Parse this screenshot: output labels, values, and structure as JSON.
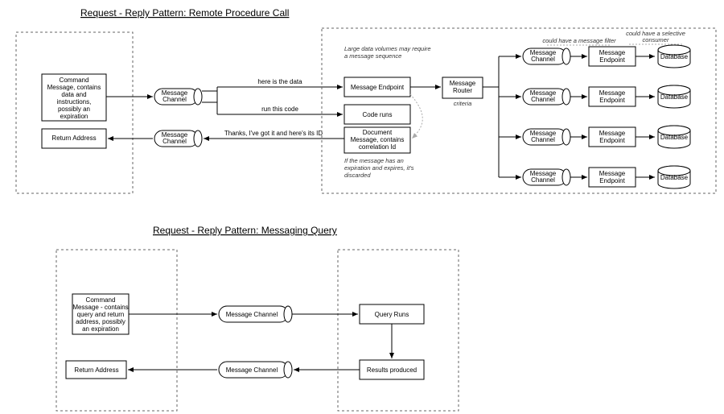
{
  "title1": "Request - Reply Pattern: Remote Procedure Call",
  "title2": "Request - Reply Pattern: Messaging Query",
  "commandMsg": [
    "Command",
    "Message, contains",
    "data and",
    "instructions,",
    "possibly an",
    "expiration"
  ],
  "returnAddr": "Return Address",
  "msgChannel": "Message\nChannel",
  "msgChannelFlat": "Message Channel",
  "hereData": "here is the data",
  "runCode": "run this code",
  "gotIt": "Thanks, I've got it and here's its ID",
  "largeData": [
    "Large data volumes may require",
    "a message sequence"
  ],
  "msgEndpoint": "Message Endpoint",
  "codeRuns": "Code runs",
  "docMsg": [
    "Document",
    "Message, contains",
    "correlation Id"
  ],
  "ifExpire": [
    "If the message has an",
    "expiration and expires, it's",
    "discarded"
  ],
  "msgRouter": "Message\nRouter",
  "criteria": "criteria",
  "couldFilter": "could have a message filter",
  "couldSelective": [
    "could have a selective",
    "consumer"
  ],
  "database": "Database",
  "commandMsg2": [
    "Command",
    "Message - contains",
    "query and return",
    "address, possibly",
    "an expiration"
  ],
  "queryRuns": "Query Runs",
  "resultsProduced": "Results produced"
}
